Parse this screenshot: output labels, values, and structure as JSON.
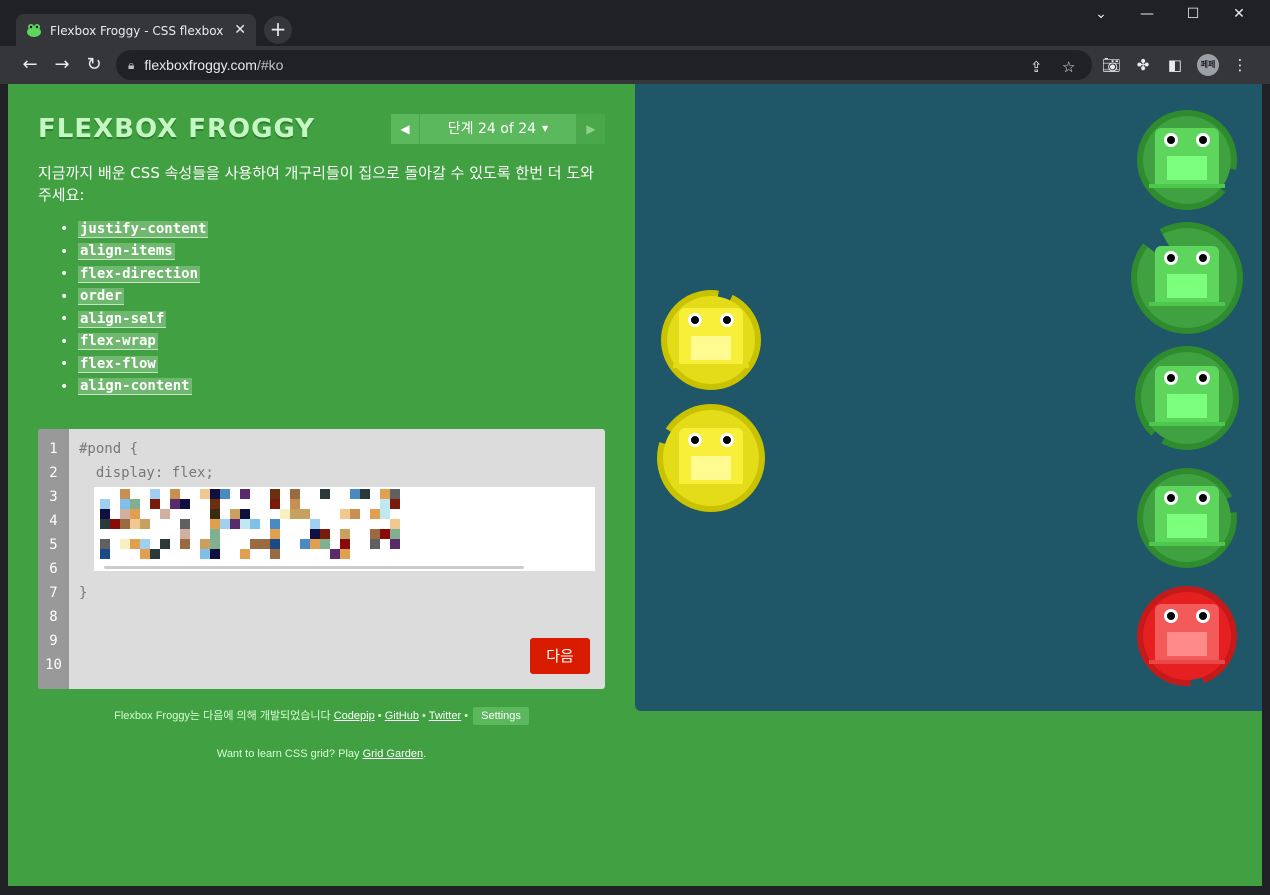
{
  "browser": {
    "tab_title": "Flexbox Froggy - CSS flexbox 속",
    "url_host": "flexboxfroggy.com",
    "url_path": "/#ko",
    "avatar_text": "페페"
  },
  "header": {
    "logo": "FLEXBOX FROGGY",
    "level_label": "단계 24 of 24",
    "prev_arrow": "◀",
    "next_arrow": "▶",
    "caret": "▼"
  },
  "instructions": "지금까지 배운 CSS 속성들을 사용하여 개구리들이 집으로 돌아갈 수 있도록 한번 더 도와주세요:",
  "properties": [
    "justify-content",
    "align-items",
    "flex-direction",
    "order",
    "align-self",
    "flex-wrap",
    "flex-flow",
    "align-content"
  ],
  "editor": {
    "line_numbers": [
      "1",
      "2",
      "3",
      "4",
      "5",
      "6",
      "7",
      "8",
      "9",
      "10"
    ],
    "line1": "#pond {",
    "line2": "  display: flex;",
    "line7": "}",
    "next_button": "다음"
  },
  "credits": {
    "prefix": "Flexbox Froggy는 다음에 의해 개발되었습니다",
    "codepip": "Codepip",
    "github": "GitHub",
    "twitter": "Twitter",
    "sep": "•",
    "settings": "Settings"
  },
  "grid_ad": {
    "text": "Want to learn CSS grid? Play",
    "link": "Grid Garden",
    "end": "."
  },
  "colors": {
    "page_bg": "#41a041",
    "pond_bg": "#1f5768",
    "green_frog": "#3fbe3f",
    "yellow_frog": "#f0e62a",
    "red_frog": "#e62020",
    "next_button": "#d91b00"
  }
}
